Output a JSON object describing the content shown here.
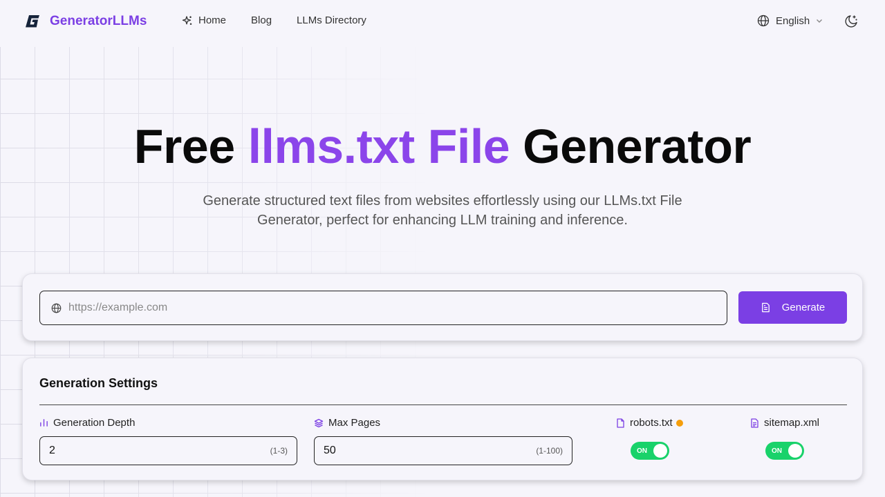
{
  "brand": {
    "name": "GeneratorLLMs",
    "logo_icon": "g-logo-icon",
    "accent": "#7b3fe4"
  },
  "nav": {
    "items": [
      {
        "label": "Home",
        "icon": "sparkle-icon"
      },
      {
        "label": "Blog"
      },
      {
        "label": "LLMs Directory"
      }
    ]
  },
  "language": {
    "label": "English",
    "icon": "globe-icon"
  },
  "theme_toggle": {
    "icon": "moon-stars-icon"
  },
  "hero": {
    "title_pre": "Free",
    "title_accent": "llms.txt File",
    "title_post": "Generator",
    "subtitle": "Generate structured text files from websites effortlessly using our LLMs.txt File Generator, perfect for enhancing LLM training and inference."
  },
  "url_form": {
    "placeholder": "https://example.com",
    "value": "",
    "generate_label": "Generate"
  },
  "settings": {
    "title": "Generation Settings",
    "depth": {
      "label": "Generation Depth",
      "value": "2",
      "hint": "(1-3)"
    },
    "max_pages": {
      "label": "Max Pages",
      "value": "50",
      "hint": "(1-100)"
    },
    "robots": {
      "label": "robots.txt",
      "toggle_label": "ON",
      "status_color": "#f59e0b"
    },
    "sitemap": {
      "label": "sitemap.xml",
      "toggle_label": "ON"
    },
    "toggle_color": "#19d26a"
  }
}
